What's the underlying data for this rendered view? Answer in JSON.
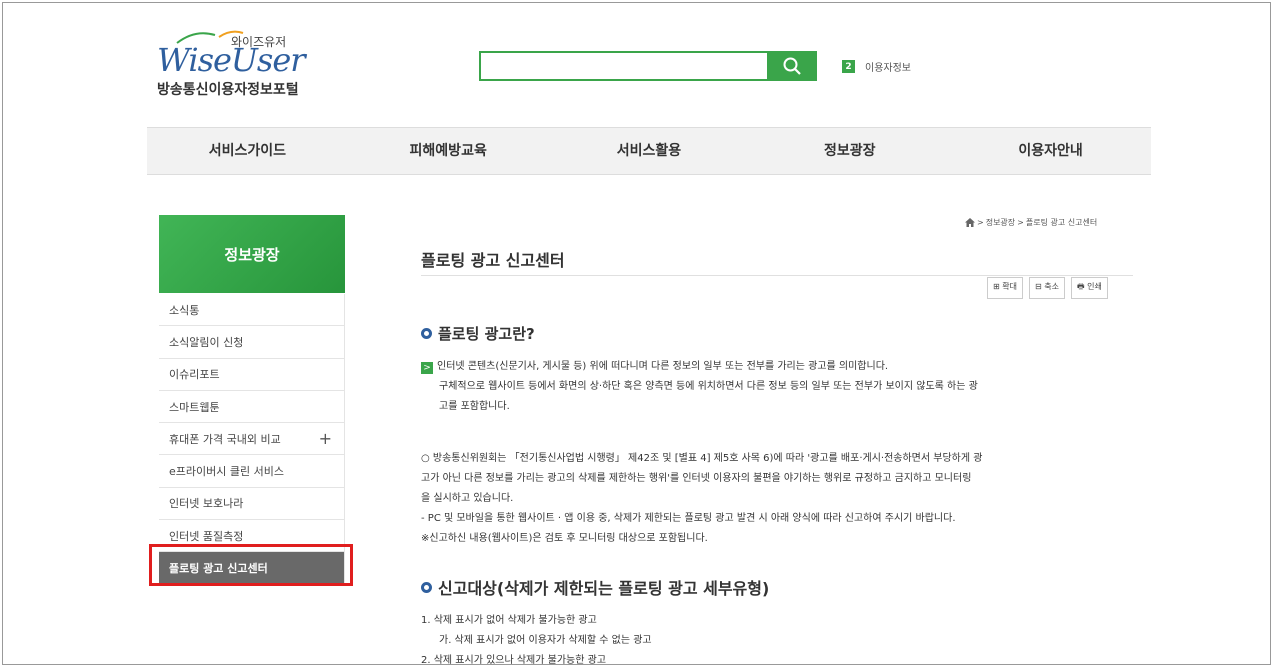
{
  "header": {
    "logo_korean": "와이즈유저",
    "logo_mark": "WiseUser",
    "logo_sub": "방송통신이용자정보포털",
    "search_placeholder": "",
    "user_badge": "2",
    "user_info": "이용자정보"
  },
  "gnb": [
    {
      "label": "서비스가이드"
    },
    {
      "label": "피해예방교육"
    },
    {
      "label": "서비스활용"
    },
    {
      "label": "정보광장"
    },
    {
      "label": "이용자안내"
    }
  ],
  "sidebar": {
    "title": "정보광장",
    "items": [
      {
        "label": "소식통"
      },
      {
        "label": "소식알림이 신청"
      },
      {
        "label": "이슈리포트"
      },
      {
        "label": "스마트웹툰"
      },
      {
        "label": "휴대폰 가격 국내외 비교",
        "plus": "+"
      },
      {
        "label": "e프라이버시 클린 서비스"
      },
      {
        "label": "인터넷 보호나라"
      },
      {
        "label": "인터넷 품질측정"
      },
      {
        "label": "플로팅 광고 신고센터"
      }
    ]
  },
  "breadcrumb": {
    "sep1": ">",
    "level1": "정보광장",
    "sep2": ">",
    "level2": "플로팅 광고 신고센터"
  },
  "page": {
    "title": "플로팅 광고 신고센터",
    "tools": {
      "zoom_in": "확대",
      "zoom_out": "축소",
      "print": "인쇄"
    },
    "section1": {
      "heading": "플로팅 광고란?",
      "badge": ">",
      "line1": "인터넷 콘텐츠(신문기사, 게시물 등) 위에 떠다니며 다른 정보의 일부 또는 전부를 가리는 광고를 의미합니다.",
      "line2": "구체적으로 웹사이트 등에서 화면의 상·하단 혹은 양측면 등에 위치하면서 다른 정보 등의 일부 또는 전부가 보이지 않도록 하는 광",
      "line3": "고를 포함합니다."
    },
    "notice": {
      "line1": "○ 방송통신위원회는 「전기통신사업법 시행령」 제42조 및 [별표 4] 제5호 사목 6)에 따라 '광고를 배포·게시·전송하면서 부당하게 광",
      "line2": "고가 아닌 다른 정보를 가리는 광고의 삭제를 제한하는 행위'를 인터넷 이용자의 불편을 야기하는 행위로 규정하고 금지하고 모니터링",
      "line3": "을 실시하고 있습니다.",
      "line4": "- PC 및 모바일을 통한 웹사이트 · 앱 이용 중, 삭제가 제한되는 플로팅 광고 발견 시 아래 양식에 따라 신고하여 주시기 바랍니다.",
      "line5": "※신고하신 내용(웹사이트)은 검토 후 모니터링 대상으로 포함됩니다."
    },
    "section2": {
      "heading": "신고대상(삭제가 제한되는 플로팅 광고 세부유형)",
      "item1": "1. 삭제 표시가 없어 삭제가 불가능한 광고",
      "item1a": "가. 삭제 표시가 없어 이용자가 삭제할 수 없는 광고",
      "item2": "2. 삭제 표시가 있으나 삭제가 불가능한 광고"
    }
  },
  "colors": {
    "accent_green": "#3aa54a",
    "heading_blue": "#2f5f9e",
    "active_gray": "#696969",
    "highlight_red": "#e01e1e"
  }
}
